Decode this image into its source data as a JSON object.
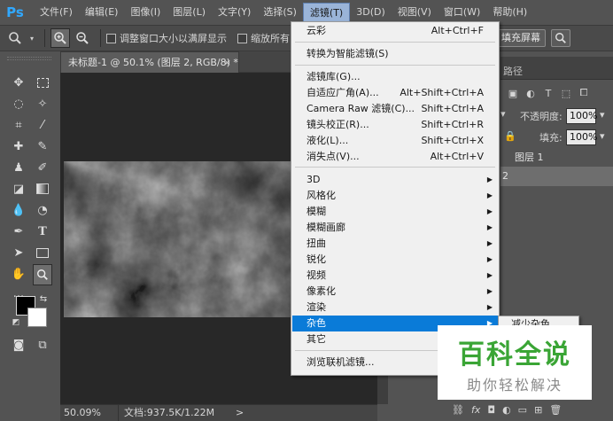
{
  "app": {
    "logo": "Ps"
  },
  "menubar": {
    "items": [
      "文件(F)",
      "编辑(E)",
      "图像(I)",
      "图层(L)",
      "文字(Y)",
      "选择(S)",
      "滤镜(T)",
      "3D(D)",
      "视图(V)",
      "窗口(W)",
      "帮助(H)"
    ],
    "active_index": 6
  },
  "options": {
    "resize_windows_label": "调整窗口大小以满屏显示",
    "zoom_all_label": "缩放所有",
    "fill_screen_label": "填充屏幕"
  },
  "document": {
    "tab_title": "未标题-1 @ 50.1% (图层 2, RGB/8) *",
    "close_glyph": "×",
    "status_zoom": "50.09%",
    "status_doc": "文档:937.5K/1.22M",
    "status_arrow": ">"
  },
  "panels": {
    "paths_tab": "路径",
    "opacity_label": "不透明度:",
    "opacity_value": "100%",
    "fill_label": "填充:",
    "fill_value": "100%",
    "layer1_name": "图层 1",
    "layer2_name": "2"
  },
  "filter_menu": {
    "items": [
      {
        "label": "云彩",
        "shortcut": "Alt+Ctrl+F"
      },
      {
        "label": "转换为智能滤镜(S)",
        "shortcut": ""
      },
      {
        "label": "滤镜库(G)...",
        "shortcut": ""
      },
      {
        "label": "自适应广角(A)...",
        "shortcut": "Alt+Shift+Ctrl+A"
      },
      {
        "label": "Camera Raw 滤镜(C)...",
        "shortcut": "Shift+Ctrl+A"
      },
      {
        "label": "镜头校正(R)...",
        "shortcut": "Shift+Ctrl+R"
      },
      {
        "label": "液化(L)...",
        "shortcut": "Shift+Ctrl+X"
      },
      {
        "label": "消失点(V)...",
        "shortcut": "Alt+Ctrl+V"
      },
      {
        "label": "3D",
        "shortcut": ""
      },
      {
        "label": "风格化",
        "shortcut": ""
      },
      {
        "label": "模糊",
        "shortcut": ""
      },
      {
        "label": "模糊画廊",
        "shortcut": ""
      },
      {
        "label": "扭曲",
        "shortcut": ""
      },
      {
        "label": "锐化",
        "shortcut": ""
      },
      {
        "label": "视频",
        "shortcut": ""
      },
      {
        "label": "像素化",
        "shortcut": ""
      },
      {
        "label": "渲染",
        "shortcut": ""
      },
      {
        "label": "杂色",
        "shortcut": ""
      },
      {
        "label": "其它",
        "shortcut": ""
      },
      {
        "label": "浏览联机滤镜...",
        "shortcut": ""
      }
    ],
    "highlighted": "杂色",
    "submenu_glyph": "▶"
  },
  "submenu": {
    "first_item": "减少杂色..."
  },
  "watermark": {
    "title": "百科全说",
    "subtitle": "助你轻松解决"
  },
  "colors": {
    "accent": "#0a7bd8",
    "ps_blue": "#31a8ff",
    "watermark_green": "#3aa535"
  }
}
